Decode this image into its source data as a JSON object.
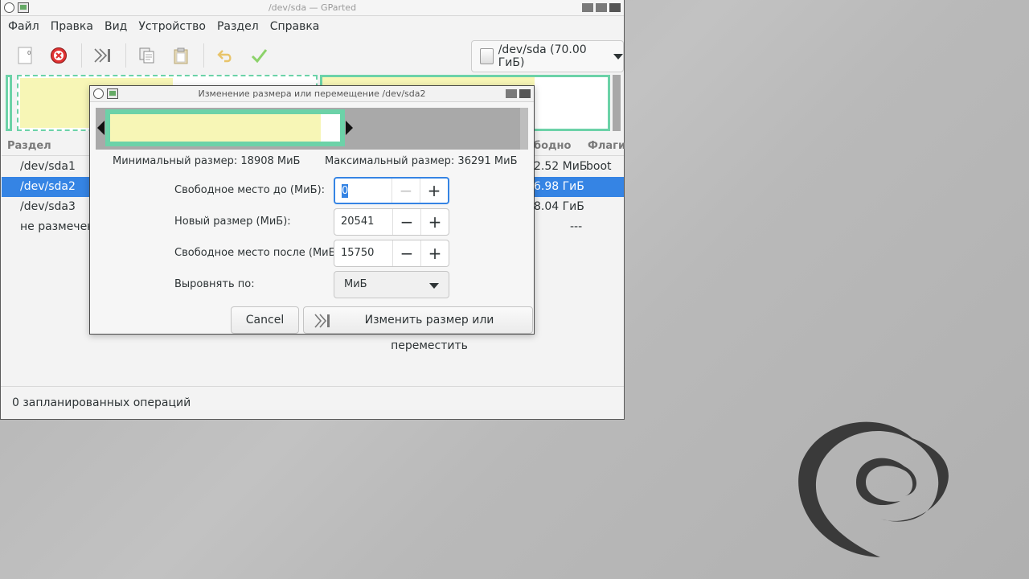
{
  "window": {
    "title": "/dev/sda — GParted"
  },
  "menubar": {
    "items": [
      "Файл",
      "Правка",
      "Вид",
      "Устройство",
      "Раздел",
      "Справка"
    ]
  },
  "toolbar": {
    "tools": [
      "new-icon",
      "delete-icon",
      "resize-move-icon",
      "copy-icon",
      "paste-icon",
      "undo-icon",
      "apply-icon"
    ],
    "device_selector": "/dev/sda (70.00 ГиБ)"
  },
  "partition_table": {
    "columns": {
      "partition": "Раздел",
      "unused": "бодно",
      "flags": "Флаги"
    },
    "rows": [
      {
        "name": "/dev/sda1",
        "unused": "2.52 МиБ",
        "flags": "boot",
        "selected": false
      },
      {
        "name": "/dev/sda2",
        "unused": "6.98 ГиБ",
        "flags": "",
        "selected": true
      },
      {
        "name": "/dev/sda3",
        "unused": "8.04 ГиБ",
        "flags": "",
        "selected": false
      },
      {
        "name": "не размечено",
        "unused": "---",
        "flags": "",
        "selected": false
      }
    ]
  },
  "statusbar": {
    "text": "0 запланированных операций"
  },
  "dialog": {
    "title": "Изменение размера или перемещение /dev/sda2",
    "min_size": "Минимальный размер: 18908 МиБ",
    "max_size": "Максимальный размер: 36291 МиБ",
    "fields": {
      "free_before": {
        "label": "Свободное место до (МиБ):",
        "value": "0"
      },
      "new_size": {
        "label": "Новый размер (МиБ):",
        "value": "20541"
      },
      "free_after": {
        "label": "Свободное место после (МиБ):",
        "value": "15750"
      },
      "align": {
        "label": "Выровнять по:",
        "value": "МиБ"
      }
    },
    "buttons": {
      "cancel": "Cancel",
      "resize": "Изменить размер или переместить"
    }
  },
  "colors": {
    "accent": "#3584e4",
    "partition_border": "#6cd2a8",
    "used_space": "#f7f6b6"
  }
}
